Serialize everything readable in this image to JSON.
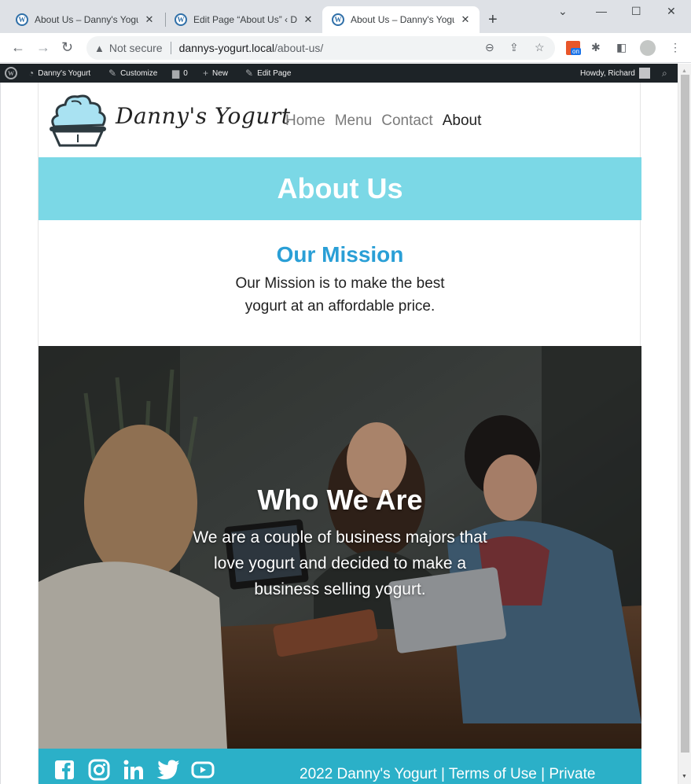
{
  "browser": {
    "tabs": [
      {
        "title": "About Us – Danny's Yogurt",
        "active": false
      },
      {
        "title": "Edit Page “About Us” ‹ Danny's Yogurt",
        "active": false
      },
      {
        "title": "About Us – Danny's Yogurt",
        "active": true
      }
    ],
    "new_tab": "+",
    "security_label": "Not secure",
    "url_host": "dannys-yogurt.local",
    "url_path": "/about-us/"
  },
  "adminbar": {
    "site_name": "Danny's Yogurt",
    "customize": "Customize",
    "comments_count": "0",
    "new": "New",
    "edit_page": "Edit Page",
    "greeting": "Howdy, Richard"
  },
  "site": {
    "title": "Danny's Yogurt",
    "nav": [
      {
        "label": "Home",
        "current": false
      },
      {
        "label": "Menu",
        "current": false
      },
      {
        "label": "Contact",
        "current": false
      },
      {
        "label": "About",
        "current": true
      }
    ],
    "banner_title": "About Us",
    "mission": {
      "heading": "Our Mission",
      "text": "Our Mission is to make the best yogurt at an affordable price."
    },
    "who": {
      "heading": "Who We Are",
      "text": "We are a couple of business majors that love yogurt and decided to make a business selling yogurt."
    },
    "footer": {
      "social": [
        "facebook-icon",
        "instagram-icon",
        "linkedin-icon",
        "twitter-icon",
        "youtube-icon"
      ],
      "text": "2022 Danny's Yogurt | Terms of Use | Private"
    }
  },
  "colors": {
    "banner": "#7bd8e6",
    "mission_heading": "#2a9fd6",
    "footer": "#2bb0c8",
    "adminbar": "#1d2327"
  }
}
